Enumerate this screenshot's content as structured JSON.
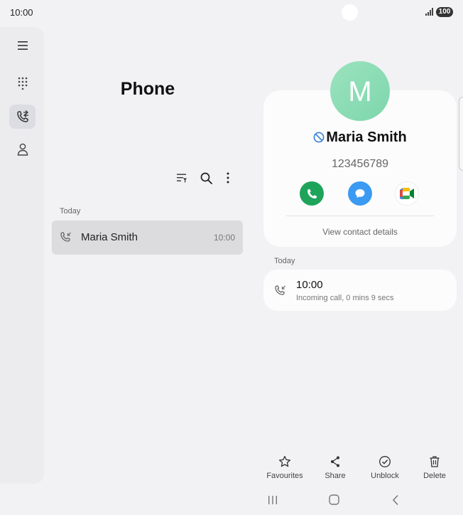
{
  "status": {
    "time": "10:00",
    "battery": "100"
  },
  "rail": {
    "items": [
      "menu-icon",
      "dialpad-icon",
      "recents-icon",
      "contacts-icon"
    ]
  },
  "page": {
    "title": "Phone"
  },
  "toolbar": {
    "icons": [
      "filter-icon",
      "search-icon",
      "more-icon"
    ]
  },
  "log": {
    "section": "Today",
    "items": [
      {
        "name": "Maria Smith",
        "time": "10:00"
      }
    ]
  },
  "contact": {
    "initial": "M",
    "name": "Maria Smith",
    "number": "123456789",
    "view_details": "View contact details",
    "colors": {
      "call": "#1ea35a",
      "message": "#3b9af1"
    }
  },
  "history": {
    "section": "Today",
    "entries": [
      {
        "time": "10:00",
        "detail": "Incoming call, 0 mins 9 secs"
      }
    ]
  },
  "bottom_bar": {
    "favourites": "Favourites",
    "share": "Share",
    "unblock": "Unblock",
    "delete": "Delete"
  }
}
